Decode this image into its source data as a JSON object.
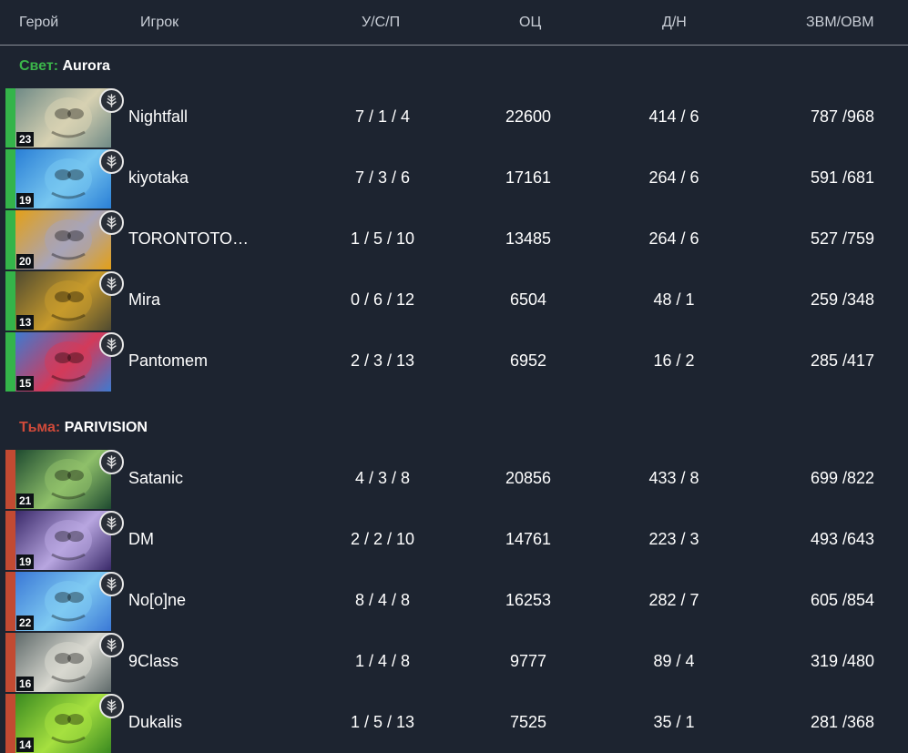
{
  "header": {
    "hero": "Герой",
    "player": "Игрок",
    "kda": "У/С/П",
    "networth": "ОЦ",
    "lhdn": "Д/Н",
    "gpm_xpm": "ЗВМ/ОВМ"
  },
  "radiant": {
    "prefix": "Свет:",
    "name": "Aurora",
    "color": "#3bb54a",
    "players": [
      {
        "level": "23",
        "player": "Nightfall",
        "kda": "7 / 1 / 4",
        "networth": "22600",
        "lhdn": "414 / 6",
        "gpm_xpm": "787 /968",
        "hero_colors": [
          "#6f8a86",
          "#d7d1b2"
        ]
      },
      {
        "level": "19",
        "player": "kiyotaka",
        "kda": "7 / 3 / 6",
        "networth": "17161",
        "lhdn": "264 / 6",
        "gpm_xpm": "591 /681",
        "hero_colors": [
          "#2a7fd6",
          "#77c6f0"
        ]
      },
      {
        "level": "20",
        "player": "TORONTOTO…",
        "kda": "1 / 5 / 10",
        "networth": "13485",
        "lhdn": "264 / 6",
        "gpm_xpm": "527 /759",
        "hero_colors": [
          "#e3a018",
          "#a8a4b8"
        ]
      },
      {
        "level": "13",
        "player": "Mira",
        "kda": "0 / 6 / 12",
        "networth": "6504",
        "lhdn": "48 / 1",
        "gpm_xpm": "259 /348",
        "hero_colors": [
          "#4f4a30",
          "#c79a2c"
        ]
      },
      {
        "level": "15",
        "player": "Pantomem",
        "kda": "2 / 3 / 13",
        "networth": "6952",
        "lhdn": "16 / 2",
        "gpm_xpm": "285 /417",
        "hero_colors": [
          "#3e7ad0",
          "#d33a5a"
        ]
      }
    ]
  },
  "dire": {
    "prefix": "Тьма:",
    "name": "PARIVISION",
    "color": "#d04a3a",
    "players": [
      {
        "level": "21",
        "player": "Satanic",
        "kda": "4 / 3 / 8",
        "networth": "20856",
        "lhdn": "433 / 8",
        "gpm_xpm": "699 /822",
        "hero_colors": [
          "#1e4a30",
          "#8fc06a"
        ]
      },
      {
        "level": "19",
        "player": "DM",
        "kda": "2 / 2 / 10",
        "networth": "14761",
        "lhdn": "223 / 3",
        "gpm_xpm": "493 /643",
        "hero_colors": [
          "#3a2a6a",
          "#b8a6e0"
        ]
      },
      {
        "level": "22",
        "player": "No[o]ne",
        "kda": "8 / 4 / 8",
        "networth": "16253",
        "lhdn": "282 / 7",
        "gpm_xpm": "605 /854",
        "hero_colors": [
          "#3a78d6",
          "#7fcaf2"
        ]
      },
      {
        "level": "16",
        "player": "9Class",
        "kda": "1 / 4 / 8",
        "networth": "9777",
        "lhdn": "89 / 4",
        "gpm_xpm": "319 /480",
        "hero_colors": [
          "#5f6a6a",
          "#d8d8d0"
        ]
      },
      {
        "level": "14",
        "player": "Dukalis",
        "kda": "1 / 5 / 13",
        "networth": "7525",
        "lhdn": "35 / 1",
        "gpm_xpm": "281 /368",
        "hero_colors": [
          "#3a8a20",
          "#a6e040"
        ]
      }
    ]
  }
}
